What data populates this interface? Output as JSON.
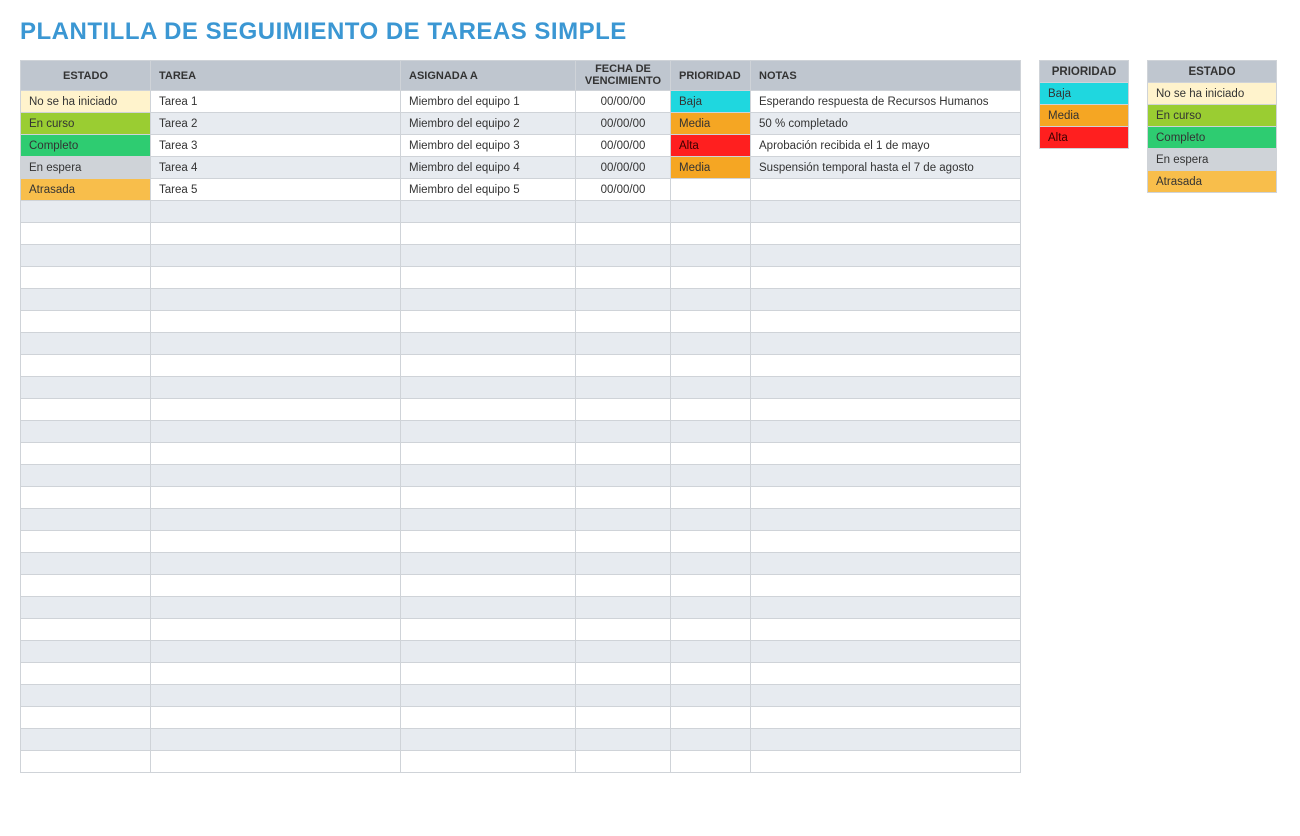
{
  "title": "PLANTILLA DE SEGUIMIENTO DE TAREAS SIMPLE",
  "columns": {
    "estado": "ESTADO",
    "tarea": "TAREA",
    "asignada": "ASIGNADA A",
    "fecha_l1": "FECHA DE",
    "fecha_l2": "VENCIMIENTO",
    "prioridad": "PRIORIDAD",
    "notas": "NOTAS"
  },
  "status_classes": {
    "No se ha iniciado": "c-not-started",
    "En curso": "c-in-progress",
    "Completo": "c-complete",
    "En espera": "c-on-hold",
    "Atrasada": "c-late"
  },
  "priority_classes": {
    "Baja": "c-low",
    "Media": "c-med",
    "Alta": "c-high c-high-dark"
  },
  "rows": [
    {
      "estado": "No se ha iniciado",
      "tarea": "Tarea 1",
      "asignada": "Miembro del equipo 1",
      "fecha": "00/00/00",
      "prioridad": "Baja",
      "notas": "Esperando respuesta de Recursos Humanos"
    },
    {
      "estado": "En curso",
      "tarea": "Tarea 2",
      "asignada": "Miembro del equipo 2",
      "fecha": "00/00/00",
      "prioridad": "Media",
      "notas": "50 % completado"
    },
    {
      "estado": "Completo",
      "tarea": "Tarea 3",
      "asignada": "Miembro del equipo 3",
      "fecha": "00/00/00",
      "prioridad": "Alta",
      "notas": "Aprobación recibida el 1 de mayo"
    },
    {
      "estado": "En espera",
      "tarea": "Tarea 4",
      "asignada": "Miembro del equipo 4",
      "fecha": "00/00/00",
      "prioridad": "Media",
      "notas": "Suspensión temporal hasta el 7 de agosto"
    },
    {
      "estado": "Atrasada",
      "tarea": "Tarea 5",
      "asignada": "Miembro del equipo 5",
      "fecha": "00/00/00",
      "prioridad": "",
      "notas": ""
    }
  ],
  "empty_row_count": 26,
  "legend_priority": {
    "header": "PRIORIDAD",
    "items": [
      "Baja",
      "Media",
      "Alta"
    ]
  },
  "legend_status": {
    "header": "ESTADO",
    "items": [
      "No se ha iniciado",
      "En curso",
      "Completo",
      "En espera",
      "Atrasada"
    ]
  }
}
